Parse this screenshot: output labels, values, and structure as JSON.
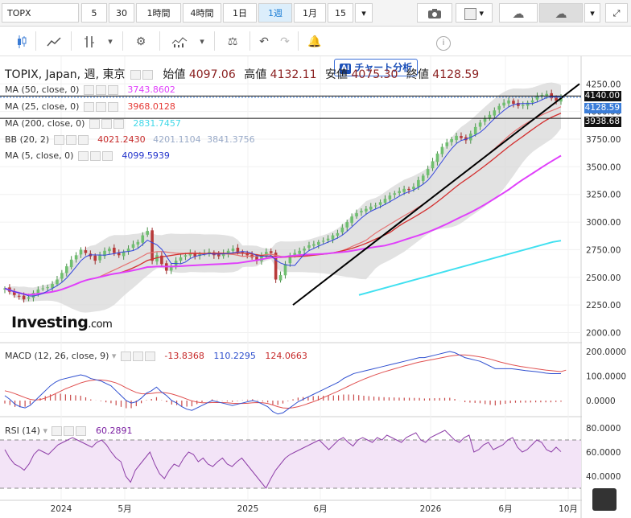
{
  "toolbar": {
    "symbol": "TOPX",
    "intervals": [
      "5",
      "30",
      "1時間",
      "4時間",
      "1日",
      "1週",
      "1月",
      "15"
    ],
    "active_interval": "1週",
    "ai_button": "チャート分析"
  },
  "legend": {
    "title": "TOPIX, Japan, 週, 東京",
    "open_label": "始値",
    "open": "4097.06",
    "high_label": "高値",
    "high": "4132.11",
    "low_label": "安値",
    "low": "4075.30",
    "close_label": "終値",
    "close": "4128.59",
    "ma50": {
      "label": "MA (50, close, 0)",
      "value": "3743.8602",
      "color": "#e040fb"
    },
    "ma25": {
      "label": "MA (25, close, 0)",
      "value": "3968.0128",
      "color": "#e53935"
    },
    "ma200": {
      "label": "MA (200, close, 0)",
      "value": "2831.7457",
      "color": "#40e0f0"
    },
    "bb": {
      "label": "BB (20, 2)",
      "mid": "4021.2430",
      "upper": "4201.1104",
      "lower": "3841.3756"
    },
    "ma5": {
      "label": "MA (5, close, 0)",
      "value": "4099.5939",
      "color": "#2233cc"
    }
  },
  "price_tags": {
    "line1": "4140.00",
    "current": "4128.59",
    "line2": "3938.68"
  },
  "macd_legend": {
    "label": "MACD (12, 26, close, 9)",
    "hist": "-13.8368",
    "macd": "110.2295",
    "signal": "124.0663"
  },
  "rsi_legend": {
    "label": "RSI (14)",
    "value": "60.2891"
  },
  "watermark": "Investing",
  "watermark_suffix": ".com",
  "chart_data": [
    {
      "type": "candlestick",
      "y_ticks": [
        "4250.00",
        "4000.00",
        "3750.00",
        "3500.00",
        "3250.00",
        "3000.00",
        "2750.00",
        "2500.00",
        "2250.00",
        "2000.00"
      ],
      "ylim": [
        2000,
        4250
      ],
      "x_ticks": [
        "2024",
        "5月",
        "2025",
        "6月",
        "2026",
        "6月",
        "10月"
      ],
      "close": [
        2400,
        2370,
        2340,
        2330,
        2300,
        2320,
        2360,
        2390,
        2400,
        2410,
        2440,
        2480,
        2540,
        2600,
        2660,
        2700,
        2750,
        2720,
        2690,
        2650,
        2700,
        2740,
        2760,
        2720,
        2700,
        2730,
        2760,
        2800,
        2820,
        2880,
        2920,
        2650,
        2700,
        2620,
        2560,
        2600,
        2650,
        2680,
        2700,
        2720,
        2690,
        2710,
        2720,
        2730,
        2700,
        2690,
        2720,
        2740,
        2760,
        2730,
        2720,
        2700,
        2680,
        2650,
        2700,
        2730,
        2720,
        2480,
        2520,
        2620,
        2700,
        2720,
        2740,
        2760,
        2790,
        2800,
        2820,
        2830,
        2850,
        2880,
        2900,
        2950,
        3000,
        3050,
        3080,
        3100,
        3120,
        3140,
        3150,
        3180,
        3210,
        3240,
        3260,
        3280,
        3300,
        3290,
        3320,
        3380,
        3420,
        3480,
        3550,
        3620,
        3680,
        3720,
        3750,
        3780,
        3760,
        3740,
        3800,
        3860,
        3900,
        3940,
        3970,
        4010,
        4050,
        4080,
        4100,
        4070,
        4050,
        4060,
        4080,
        4100,
        4140,
        4150,
        4160,
        4120,
        4097,
        4128.59
      ],
      "series": [
        {
          "name": "MA (50, close, 0)",
          "last": 3743.8602
        },
        {
          "name": "MA (25, close, 0)",
          "last": 3968.0128
        },
        {
          "name": "MA (200, close, 0)",
          "last": 2831.7457
        },
        {
          "name": "BB (20, 2)",
          "last": 4021.243
        },
        {
          "name": "MA (5, close, 0)",
          "last": 4099.5939
        }
      ]
    },
    {
      "type": "line",
      "title": "MACD (12, 26, close, 9)",
      "y_ticks": [
        "200.0000",
        "100.0000",
        "0.0000"
      ],
      "ylim": [
        -40,
        220
      ],
      "series": [
        {
          "name": "MACD",
          "values": [
            20,
            5,
            -15,
            -25,
            -30,
            -20,
            0,
            20,
            40,
            60,
            75,
            85,
            90,
            95,
            100,
            105,
            100,
            90,
            85,
            80,
            70,
            60,
            40,
            20,
            0,
            -10,
            -5,
            10,
            30,
            40,
            55,
            35,
            20,
            0,
            -10,
            -25,
            -35,
            -40,
            -30,
            -20,
            -10,
            0,
            -5,
            -10,
            -15,
            -20,
            -15,
            -10,
            -5,
            0,
            -5,
            -15,
            -25,
            -45,
            -55,
            -50,
            -35,
            -20,
            -5,
            5,
            15,
            25,
            35,
            45,
            55,
            65,
            75,
            90,
            100,
            110,
            115,
            120,
            125,
            130,
            135,
            140,
            145,
            150,
            155,
            160,
            165,
            170,
            175,
            175,
            180,
            185,
            190,
            195,
            200,
            195,
            185,
            175,
            170,
            165,
            160,
            150,
            140,
            130,
            130,
            130,
            130,
            128,
            125,
            122,
            120,
            118,
            115,
            112,
            110,
            110,
            110
          ]
        },
        {
          "name": "Signal",
          "values": [
            40,
            35,
            28,
            20,
            12,
            5,
            2,
            4,
            10,
            18,
            28,
            38,
            48,
            56,
            64,
            72,
            78,
            82,
            84,
            84,
            82,
            78,
            72,
            63,
            52,
            42,
            33,
            28,
            27,
            29,
            32,
            33,
            31,
            27,
            21,
            14,
            6,
            -1,
            -6,
            -9,
            -9,
            -8,
            -8,
            -8,
            -9,
            -11,
            -12,
            -12,
            -11,
            -9,
            -8,
            -9,
            -12,
            -18,
            -25,
            -30,
            -31,
            -29,
            -25,
            -19,
            -12,
            -5,
            3,
            12,
            21,
            30,
            39,
            49,
            59,
            69,
            78,
            87,
            95,
            103,
            110,
            117,
            123,
            129,
            135,
            141,
            146,
            152,
            157,
            161,
            165,
            169,
            173,
            177,
            181,
            184,
            186,
            186,
            184,
            181,
            178,
            174,
            169,
            163,
            157,
            152,
            147,
            143,
            139,
            136,
            133,
            130,
            127,
            124,
            122,
            120,
            118,
            124
          ]
        }
      ]
    },
    {
      "type": "line",
      "title": "RSI (14)",
      "y_ticks": [
        "80.0000",
        "60.0000",
        "40.0000"
      ],
      "ylim": [
        25,
        85
      ],
      "series": [
        {
          "name": "RSI",
          "values": [
            62,
            55,
            50,
            48,
            45,
            50,
            58,
            62,
            60,
            58,
            62,
            66,
            68,
            70,
            72,
            70,
            68,
            66,
            64,
            68,
            70,
            66,
            60,
            55,
            52,
            40,
            35,
            45,
            50,
            55,
            60,
            50,
            42,
            38,
            45,
            50,
            48,
            55,
            60,
            58,
            52,
            55,
            50,
            48,
            52,
            55,
            50,
            48,
            52,
            55,
            50,
            45,
            40,
            35,
            30,
            38,
            45,
            50,
            55,
            58,
            60,
            62,
            64,
            66,
            68,
            70,
            66,
            62,
            66,
            70,
            72,
            68,
            65,
            70,
            72,
            70,
            68,
            72,
            70,
            74,
            72,
            70,
            68,
            72,
            74,
            76,
            70,
            68,
            72,
            74,
            76,
            78,
            74,
            70,
            68,
            72,
            74,
            60,
            62,
            66,
            68,
            62,
            64,
            66,
            70,
            72,
            64,
            60,
            62,
            66,
            70,
            68,
            62,
            60,
            64,
            60.2891
          ]
        }
      ],
      "bands": [
        70,
        30
      ]
    }
  ]
}
